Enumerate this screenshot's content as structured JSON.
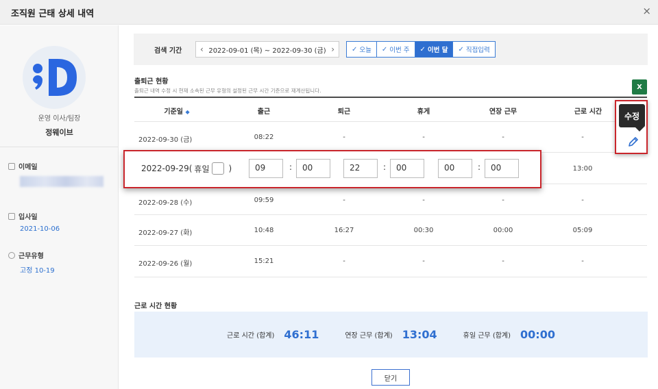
{
  "header": {
    "title": "조직원 근태 상세 내역",
    "close_icon": "×"
  },
  "sidebar": {
    "role": "운영 이사/팀장",
    "name": "정웨이브",
    "email_label": "이메일",
    "join_label": "입사일",
    "join_value": "2021-10-06",
    "worktype_label": "근무유형",
    "worktype_value": "고정 10-19"
  },
  "search": {
    "label": "검색 기간",
    "date_range": "2022-09-01 (목) ~ 2022-09-30 (금)",
    "prev_icon": "‹",
    "next_icon": "›",
    "segments": [
      "오늘",
      "이번 주",
      "이번 달",
      "직접입력"
    ],
    "active_segment": "이번 달"
  },
  "section": {
    "title": "출퇴근 현황",
    "subtitle": "출퇴근 내역 수정 시 현재 소속된 근무 유형의 설정된 근무 시간 기준으로 재계산됩니다.",
    "excel_icon": "X"
  },
  "table": {
    "columns": [
      "기준일",
      "출근",
      "퇴근",
      "휴게",
      "연장 근무",
      "근로 시간"
    ],
    "sort_icon": "◆",
    "rows": [
      {
        "date": "2022-09-30 (금)",
        "in": "08:22",
        "out": "-",
        "rest": "-",
        "overtime": "-",
        "work": "-"
      },
      {
        "date": "2022-09-28 (수)",
        "in": "09:59",
        "out": "-",
        "rest": "-",
        "overtime": "-",
        "work": "-"
      },
      {
        "date": "2022-09-27 (화)",
        "in": "10:48",
        "out": "16:27",
        "rest": "00:30",
        "overtime": "00:00",
        "work": "05:09"
      },
      {
        "date": "2022-09-26 (월)",
        "in": "15:21",
        "out": "-",
        "rest": "-",
        "overtime": "-",
        "work": "-"
      }
    ],
    "edit_row": {
      "date": "2022-09-29(",
      "holiday_label": "휴일",
      "close_paren": ")",
      "in_h": "09",
      "in_m": "00",
      "out_h": "22",
      "out_m": "00",
      "rest_h": "00",
      "rest_m": "00",
      "colon": ":",
      "work": "13:00"
    }
  },
  "tooltip": {
    "label": "수정"
  },
  "summary": {
    "title": "근로 시간 현황",
    "items": [
      {
        "label": "근로 시간 (합계)",
        "value": "46:11"
      },
      {
        "label": "연장 근무 (합계)",
        "value": "13:04"
      },
      {
        "label": "휴일 근무 (합계)",
        "value": "00:00"
      }
    ]
  },
  "footer": {
    "close_label": "닫기"
  },
  "colors": {
    "accent": "#2f6fd0",
    "highlight": "#c9252b",
    "excel": "#1f7b45"
  }
}
